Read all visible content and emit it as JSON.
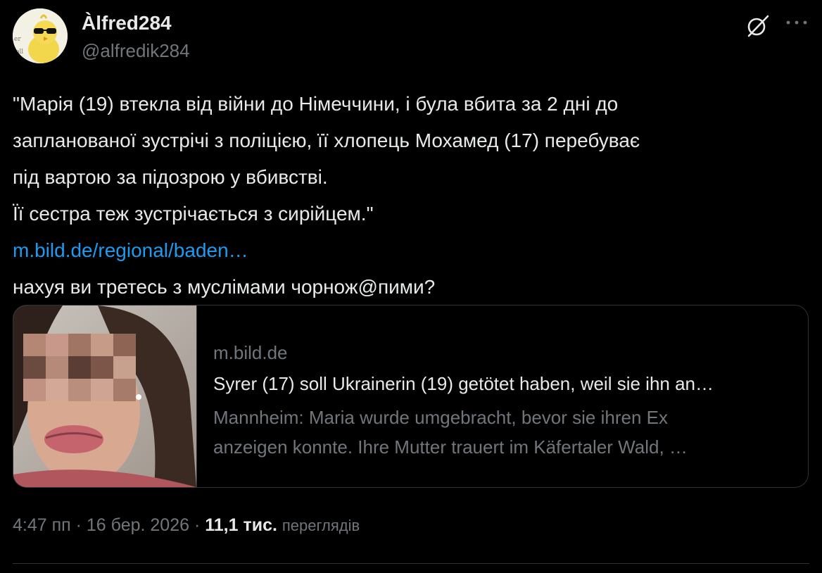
{
  "author": {
    "display_name": "Àlfred284",
    "handle": "@alfredik284"
  },
  "icons": {
    "avatar": "chick-with-sunglasses-avatar",
    "grok": "grok-slash-icon",
    "more": "more-horizontal-icon"
  },
  "tweet": {
    "lines": [
      "\"Марія (19) втекла від війни до Німеччини, і була вбита за 2 дні до",
      "запланованої зустрічі з поліцією, її хлопець Мохамед (17) перебуває",
      "під вартою за підозрою у вбивстві.",
      "Її сестра теж зустрічається з сирійцем.\""
    ],
    "link_text": "m.bild.de/regional/baden…",
    "closing_line": "нахуя ви третесь з муслімами чорнож@пими?"
  },
  "card": {
    "domain": "m.bild.de",
    "title": "Syrer (17) soll Ukrainerin (19) getötet haben, weil sie ihn an…",
    "description_lines": [
      "Mannheim: Maria wurde umgebracht, bevor sie ihren Ex",
      "anzeigen konnte. Ihre Mutter trauert im Käfertaler Wald, …"
    ]
  },
  "meta": {
    "time": "4:47 пп",
    "sep1": " · ",
    "date": "16 бер. 2026",
    "sep2": " · ",
    "views_count": "11,1 тис.",
    "views_label": "переглядів"
  },
  "colors": {
    "background": "#000000",
    "text": "#e7e9ea",
    "secondary": "#71767b",
    "link": "#1d9bf0",
    "border": "#2f3336"
  }
}
